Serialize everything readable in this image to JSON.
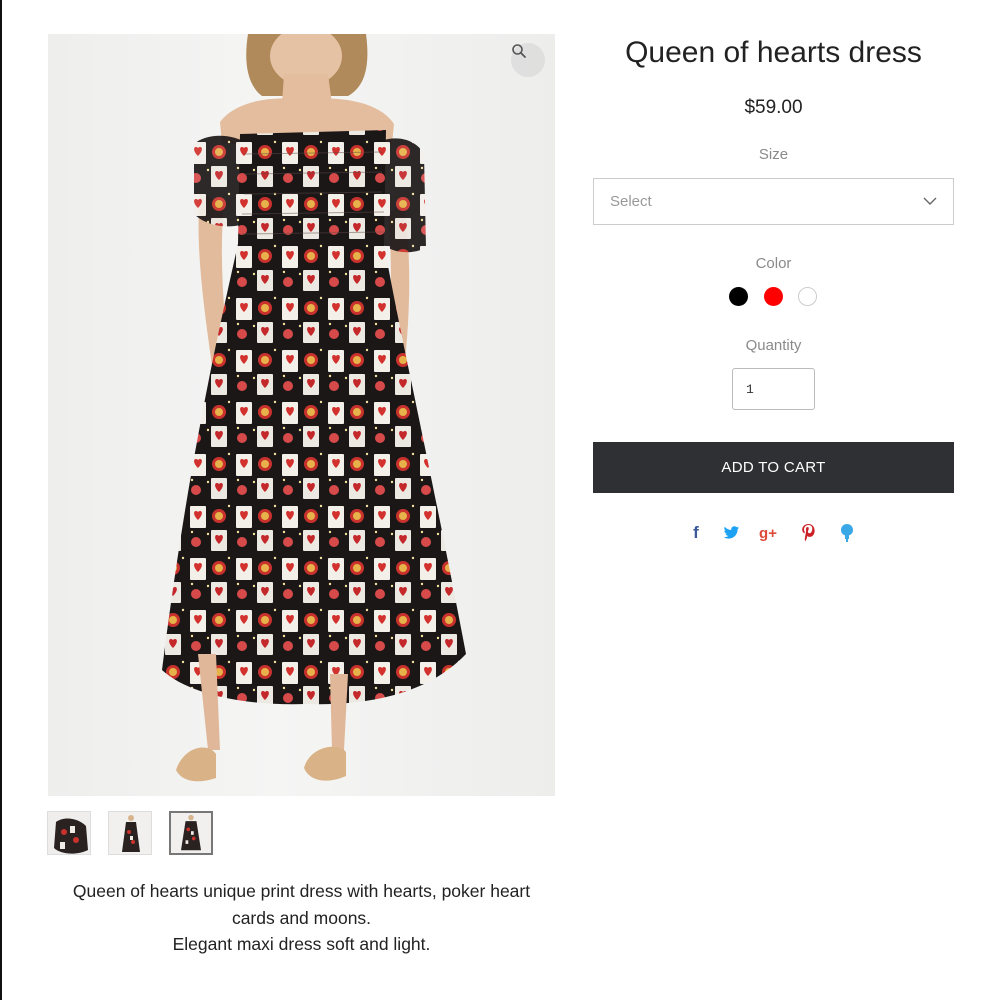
{
  "product": {
    "title": "Queen of hearts dress",
    "price": "$59.00",
    "description_lines": [
      "Queen of hearts unique print dress with hearts, poker heart",
      "cards and moons.",
      "Elegant maxi dress soft and light."
    ]
  },
  "gallery": {
    "zoom_icon": "search-icon",
    "thumbnail_count": 3,
    "active_thumbnail": 3
  },
  "options": {
    "size": {
      "label": "Size",
      "selected": "Select"
    },
    "color": {
      "label": "Color",
      "swatches": [
        {
          "name": "black",
          "hex": "#000000"
        },
        {
          "name": "red",
          "hex": "#ff0000"
        },
        {
          "name": "white",
          "hex": "#ffffff"
        }
      ]
    },
    "quantity": {
      "label": "Quantity",
      "value": "1"
    }
  },
  "cart": {
    "button_label": "ADD TO CART"
  },
  "share": {
    "icons": [
      {
        "name": "facebook-icon",
        "glyph": "f",
        "color": "#3b5998"
      },
      {
        "name": "twitter-icon",
        "glyph": "",
        "color": "#1da1f2"
      },
      {
        "name": "google-plus-icon",
        "glyph": "g+",
        "color": "#dd4b39"
      },
      {
        "name": "pinterest-icon",
        "glyph": "P",
        "color": "#cb2027"
      },
      {
        "name": "fancy-icon",
        "glyph": "",
        "color": "#3aa8e6"
      }
    ]
  }
}
